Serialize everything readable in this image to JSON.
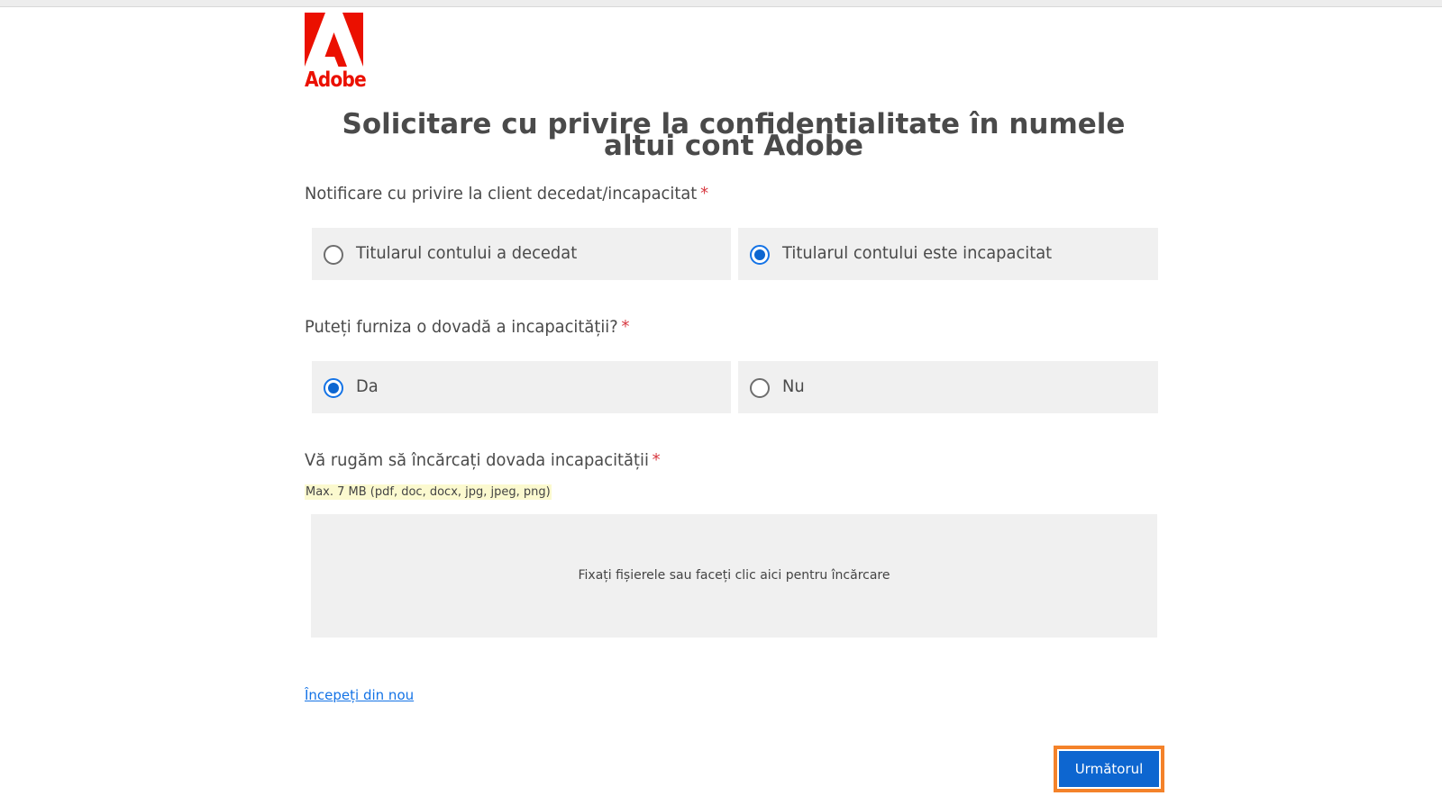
{
  "logo": {
    "wordmark": "Adobe",
    "brand_color": "#eb1000"
  },
  "page": {
    "title": "Solicitare cu privire la confidentialitate în numele altui cont Adobe"
  },
  "question1": {
    "label": "Notificare cu privire la client decedat/incapacitat",
    "required_mark": "*",
    "options": [
      {
        "label": "Titularul contului a decedat",
        "selected": false
      },
      {
        "label": "Titularul contului este incapacitat",
        "selected": true
      }
    ]
  },
  "question2": {
    "label": "Puteți furniza o dovadă a incapacității?",
    "required_mark": "*",
    "options": [
      {
        "label": "Da",
        "selected": true
      },
      {
        "label": "Nu",
        "selected": false
      }
    ]
  },
  "upload": {
    "label": "Vă rugăm să încărcați dovada incapacității",
    "required_mark": "*",
    "hint": "Max. 7 MB (pdf, doc, docx, jpg, jpeg, png)",
    "dropzone_text": "Fixați fișierele sau faceți clic aici pentru încărcare"
  },
  "actions": {
    "restart_label": "Începeți din nou",
    "next_label": "Următorul"
  },
  "colors": {
    "accent": "#0d66d0",
    "required": "#d7373f",
    "focus_outline": "#f4822a"
  }
}
